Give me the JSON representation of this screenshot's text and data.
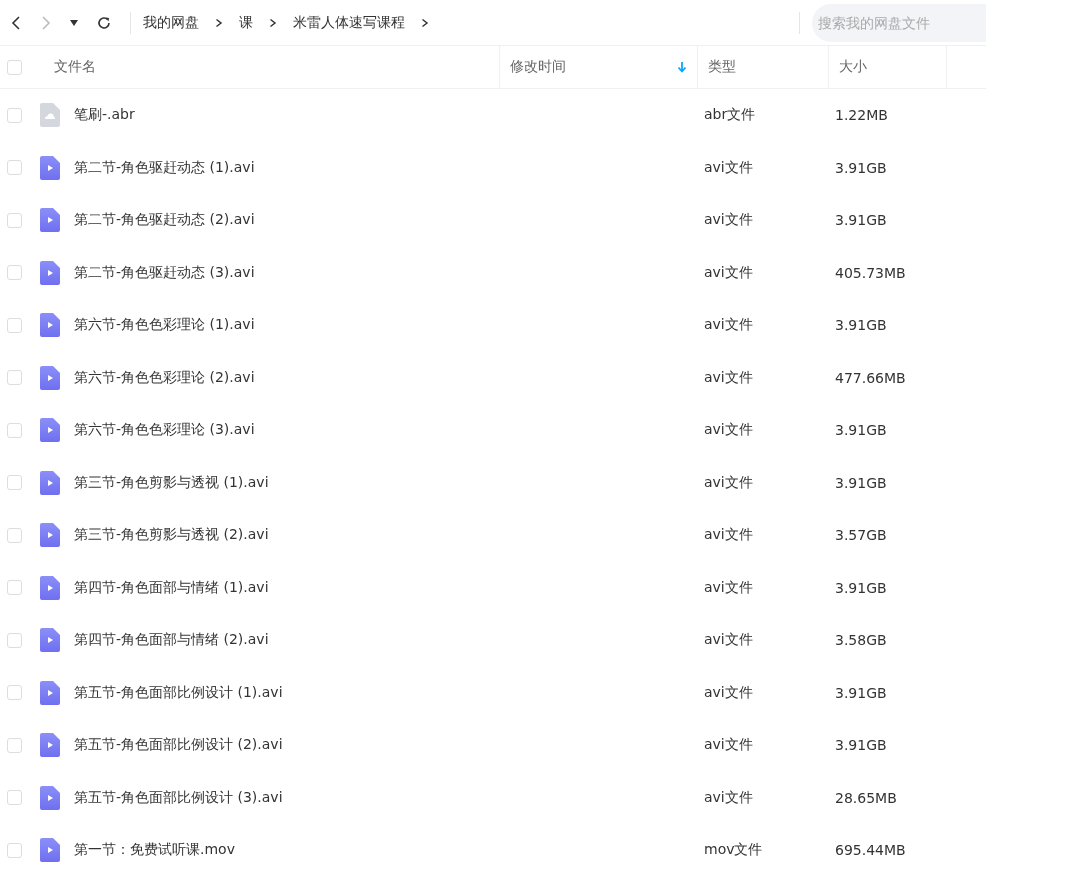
{
  "toolbar": {
    "breadcrumbs": [
      "我的网盘",
      "课",
      "米雷人体速写课程"
    ],
    "search": {
      "placeholder": "搜索我的网盘文件"
    }
  },
  "table": {
    "select_all": {
      "checked": false
    },
    "columns": [
      {
        "label": "文件名",
        "sorted": false
      },
      {
        "label": "修改时间",
        "sorted": true
      },
      {
        "label": "类型",
        "sorted": false
      },
      {
        "label": "大小",
        "sorted": false
      }
    ],
    "rows": [
      {
        "kind": "file",
        "name": "笔刷-.abr",
        "type": "abr文件",
        "size": "1.22MB",
        "checked": false
      },
      {
        "kind": "video",
        "name": "第二节-角色驱赶动态 (1).avi",
        "type": "avi文件",
        "size": "3.91GB",
        "checked": false
      },
      {
        "kind": "video",
        "name": "第二节-角色驱赶动态 (2).avi",
        "type": "avi文件",
        "size": "3.91GB",
        "checked": false
      },
      {
        "kind": "video",
        "name": "第二节-角色驱赶动态 (3).avi",
        "type": "avi文件",
        "size": "405.73MB",
        "checked": false
      },
      {
        "kind": "video",
        "name": "第六节-角色色彩理论 (1).avi",
        "type": "avi文件",
        "size": "3.91GB",
        "checked": false
      },
      {
        "kind": "video",
        "name": "第六节-角色色彩理论 (2).avi",
        "type": "avi文件",
        "size": "477.66MB",
        "checked": false
      },
      {
        "kind": "video",
        "name": "第六节-角色色彩理论 (3).avi",
        "type": "avi文件",
        "size": "3.91GB",
        "checked": false
      },
      {
        "kind": "video",
        "name": "第三节-角色剪影与透视 (1).avi",
        "type": "avi文件",
        "size": "3.91GB",
        "checked": false
      },
      {
        "kind": "video",
        "name": "第三节-角色剪影与透视 (2).avi",
        "type": "avi文件",
        "size": "3.57GB",
        "checked": false
      },
      {
        "kind": "video",
        "name": "第四节-角色面部与情绪 (1).avi",
        "type": "avi文件",
        "size": "3.91GB",
        "checked": false
      },
      {
        "kind": "video",
        "name": "第四节-角色面部与情绪 (2).avi",
        "type": "avi文件",
        "size": "3.58GB",
        "checked": false
      },
      {
        "kind": "video",
        "name": "第五节-角色面部比例设计 (1).avi",
        "type": "avi文件",
        "size": "3.91GB",
        "checked": false
      },
      {
        "kind": "video",
        "name": "第五节-角色面部比例设计 (2).avi",
        "type": "avi文件",
        "size": "3.91GB",
        "checked": false
      },
      {
        "kind": "video",
        "name": "第五节-角色面部比例设计 (3).avi",
        "type": "avi文件",
        "size": "28.65MB",
        "checked": false
      },
      {
        "kind": "video",
        "name": "第一节：免费试听课.mov",
        "type": "mov文件",
        "size": "695.44MB",
        "checked": false
      }
    ]
  }
}
